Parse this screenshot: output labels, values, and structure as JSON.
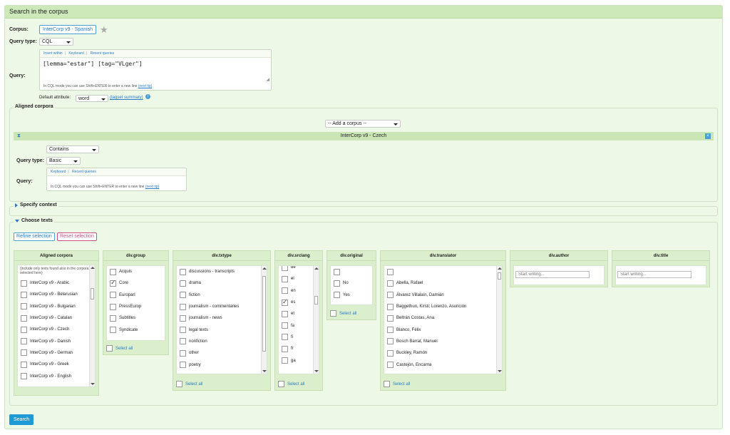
{
  "page": {
    "title": "Search in the corpus"
  },
  "corpus": {
    "label": "Corpus:",
    "value": "InterCorp v9 - Spanish",
    "star_icon": "star-icon"
  },
  "query_type": {
    "label": "Query type:",
    "value": "CQL"
  },
  "query": {
    "label": "Query:",
    "toolbar": [
      "Insert within",
      "Keyboard",
      "Recent queries"
    ],
    "text": "[lemma=\"estar\"] [tag=\"VLger\"]",
    "hint": "In CQL mode you can use Shift+ENTER to enter a new line",
    "hint_link": "(next tip)"
  },
  "default_attr": {
    "label": "Default attribute:",
    "value": "word",
    "tagset_link": "(tagset summary)"
  },
  "aligned": {
    "legend": "Aligned corpora",
    "add_corpus": "-- Add a corpus --",
    "bar_title": "InterCorp v9 - Czech",
    "contains": "Contains",
    "query_type_label": "Query type:",
    "query_type_value": "Basic",
    "query_label": "Query:",
    "toolbar": [
      "Keyboard",
      "Recent queries"
    ],
    "hint": "In CQL mode you can use Shift+ENTER to enter a new line",
    "hint_link": "(next tip)"
  },
  "specify_context": "Specify context",
  "choose_texts": {
    "legend": "Choose texts",
    "refine": "Refine selection",
    "reset": "Reset selection",
    "select_all": "Select all",
    "aligned_panel": {
      "title": "Aligned corpora",
      "note": "(include only texts found also in the corpora selected here)",
      "items": [
        "InterCorp v9 - Arabic",
        "InterCorp v9 - Belarusian",
        "InterCorp v9 - Bulgarian",
        "InterCorp v9 - Catalan",
        "InterCorp v9 - Czech",
        "InterCorp v9 - Danish",
        "InterCorp v9 - German",
        "InterCorp v9 - Greek",
        "InterCorp v9 - English"
      ]
    },
    "group_panel": {
      "title": "div.group",
      "items": [
        "Acquis",
        "Core",
        "Europarl",
        "PressEurop",
        "Subtitles",
        "Syndicate"
      ],
      "checked": [
        false,
        true,
        false,
        false,
        false,
        false
      ]
    },
    "txtype_panel": {
      "title": "div.txtype",
      "items": [
        "discussions - transcripts",
        "drama",
        "fiction",
        "journalism - commentaries",
        "journalism - news",
        "legal texts",
        "nonfiction",
        "other",
        "poetry"
      ]
    },
    "srclang_panel": {
      "title": "div.srclang",
      "items": [
        "de",
        "el",
        "en",
        "es",
        "et",
        "fa",
        "fi",
        "fr",
        "ga"
      ],
      "checked": [
        false,
        false,
        false,
        true,
        false,
        false,
        false,
        false,
        false
      ]
    },
    "original_panel": {
      "title": "div.original",
      "items": [
        "",
        "No",
        "Yes"
      ]
    },
    "translator_panel": {
      "title": "div.translator",
      "items": [
        "",
        "Abella, Rafael",
        "Álvarez Villalaín, Damián",
        "Baggethun, Kirsti; Lorenzo, Asunción",
        "Beltrán Costas, Ana",
        "Blanco, Félix",
        "Bosch Barrat, Manuel",
        "Buckley, Ramón",
        "Castejón, Encarna"
      ]
    },
    "author_panel": {
      "title": "div.author",
      "placeholder": "Start writing..."
    },
    "title_panel": {
      "title": "div.title",
      "placeholder": "Start writing..."
    }
  },
  "search_button": "Search",
  "colors": {
    "accent": "#1e9ad6",
    "header_green": "#cde8b9",
    "page_bg": "#eef8e6",
    "reset_pink": "#d04f88"
  }
}
